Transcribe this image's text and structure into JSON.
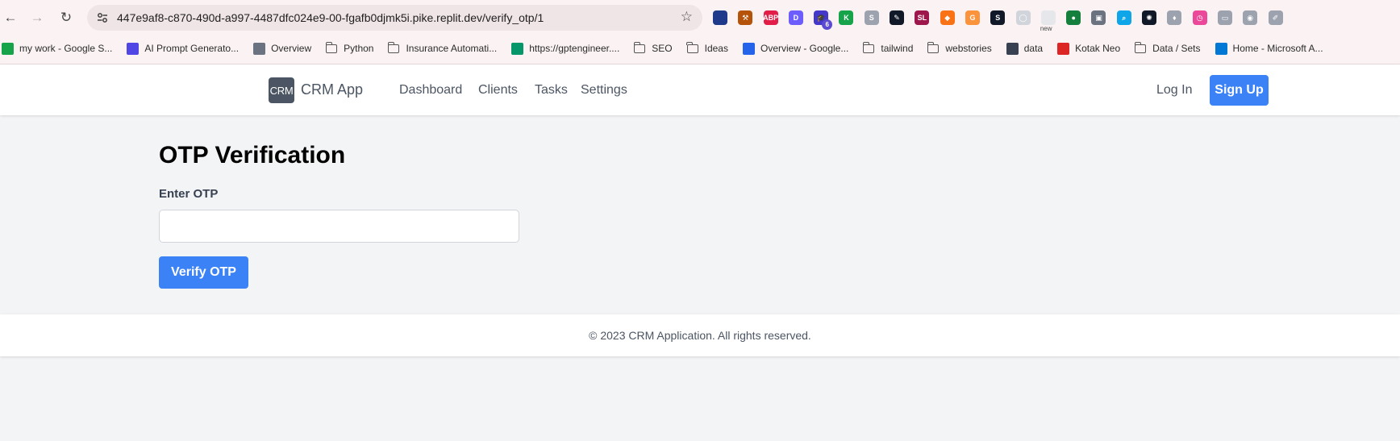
{
  "browser": {
    "url": "447e9af8-c870-490d-a997-4487dfc024e9-00-fgafb0djmk5i.pike.replit.dev/verify_otp/1",
    "extensions": [
      {
        "name": "half-moon-extension",
        "label": "",
        "color": "#1f3a8a"
      },
      {
        "name": "hammer-extension",
        "label": "⚒",
        "color": "#b45309"
      },
      {
        "name": "adblock-extension",
        "label": "ABP",
        "color": "#e11d48"
      },
      {
        "name": "d-extension",
        "label": "D",
        "color": "#6d5dfc"
      },
      {
        "name": "graduation-extension",
        "label": "🎓",
        "color": "#4338ca",
        "badge": "6"
      },
      {
        "name": "k-extension",
        "label": "K",
        "color": "#16a34a"
      },
      {
        "name": "grey-s-extension",
        "label": "S",
        "color": "#9ca3af"
      },
      {
        "name": "eyedropper-extension",
        "label": "✎",
        "color": "#111827"
      },
      {
        "name": "sl-extension",
        "label": "SL",
        "color": "#9d174d"
      },
      {
        "name": "orange-extension",
        "label": "◆",
        "color": "#f97316"
      },
      {
        "name": "g-extension",
        "label": "G",
        "color": "#fb923c"
      },
      {
        "name": "s-box-extension",
        "label": "S",
        "color": "#111827"
      },
      {
        "name": "mouse-extension",
        "label": "◯",
        "color": "#d1d5db"
      },
      {
        "name": "new-extension",
        "label": "",
        "color": "#e5e7eb",
        "badge_text": "new"
      },
      {
        "name": "globe-extension",
        "label": "●",
        "color": "#15803d"
      },
      {
        "name": "screen-extension",
        "label": "▣",
        "color": "#6b7280"
      },
      {
        "name": "search-extension",
        "label": "⌕",
        "color": "#0ea5e9"
      },
      {
        "name": "chatgpt-extension",
        "label": "✺",
        "color": "#111827"
      },
      {
        "name": "pin-extension",
        "label": "♦",
        "color": "#9ca3af"
      },
      {
        "name": "clock-extension",
        "label": "◷",
        "color": "#ec4899"
      },
      {
        "name": "cast-extension",
        "label": "▭",
        "color": "#9ca3af"
      },
      {
        "name": "camera-extension",
        "label": "◉",
        "color": "#9ca3af"
      },
      {
        "name": "pen-extension",
        "label": "✐",
        "color": "#9ca3af"
      }
    ],
    "bookmarks": [
      {
        "name": "bookmark-my-work",
        "label": "my work - Google S...",
        "icon": "sheets-icon",
        "type": "site"
      },
      {
        "name": "bookmark-ai-prompt",
        "label": "AI Prompt Generato...",
        "icon": "ai-icon",
        "type": "site"
      },
      {
        "name": "bookmark-overview",
        "label": "Overview",
        "icon": "gear-icon",
        "type": "site"
      },
      {
        "name": "bookmark-python",
        "label": "Python",
        "icon": "folder-icon",
        "type": "folder"
      },
      {
        "name": "bookmark-insurance",
        "label": "Insurance Automati...",
        "icon": "folder-icon",
        "type": "folder"
      },
      {
        "name": "bookmark-gptengineer",
        "label": "https://gptengineer....",
        "icon": "gpt-icon",
        "type": "site"
      },
      {
        "name": "bookmark-seo",
        "label": "SEO",
        "icon": "folder-icon",
        "type": "folder"
      },
      {
        "name": "bookmark-ideas",
        "label": "Ideas",
        "icon": "folder-icon",
        "type": "folder"
      },
      {
        "name": "bookmark-overview-google",
        "label": "Overview - Google...",
        "icon": "google-ads-icon",
        "type": "site"
      },
      {
        "name": "bookmark-tailwind",
        "label": "tailwind",
        "icon": "folder-icon",
        "type": "folder"
      },
      {
        "name": "bookmark-webstories",
        "label": "webstories",
        "icon": "folder-icon",
        "type": "folder"
      },
      {
        "name": "bookmark-data",
        "label": "data",
        "icon": "globe-icon",
        "type": "site"
      },
      {
        "name": "bookmark-kotak-neo",
        "label": "Kotak Neo",
        "icon": "neo-icon",
        "type": "site"
      },
      {
        "name": "bookmark-data-sets",
        "label": "Data / Sets",
        "icon": "folder-icon",
        "type": "folder"
      },
      {
        "name": "bookmark-home-microsoft",
        "label": "Home - Microsoft A...",
        "icon": "azure-icon",
        "type": "site"
      }
    ]
  },
  "app": {
    "logo_text": "CRM",
    "name": "CRM App",
    "nav": [
      "Dashboard",
      "Clients",
      "Tasks",
      "Settings"
    ],
    "login_label": "Log In",
    "signup_label": "Sign Up",
    "accent_color": "#3b82f6"
  },
  "main": {
    "title": "OTP Verification",
    "otp_label": "Enter OTP",
    "otp_value": "",
    "verify_label": "Verify OTP"
  },
  "footer": {
    "text": "© 2023 CRM Application. All rights reserved."
  }
}
